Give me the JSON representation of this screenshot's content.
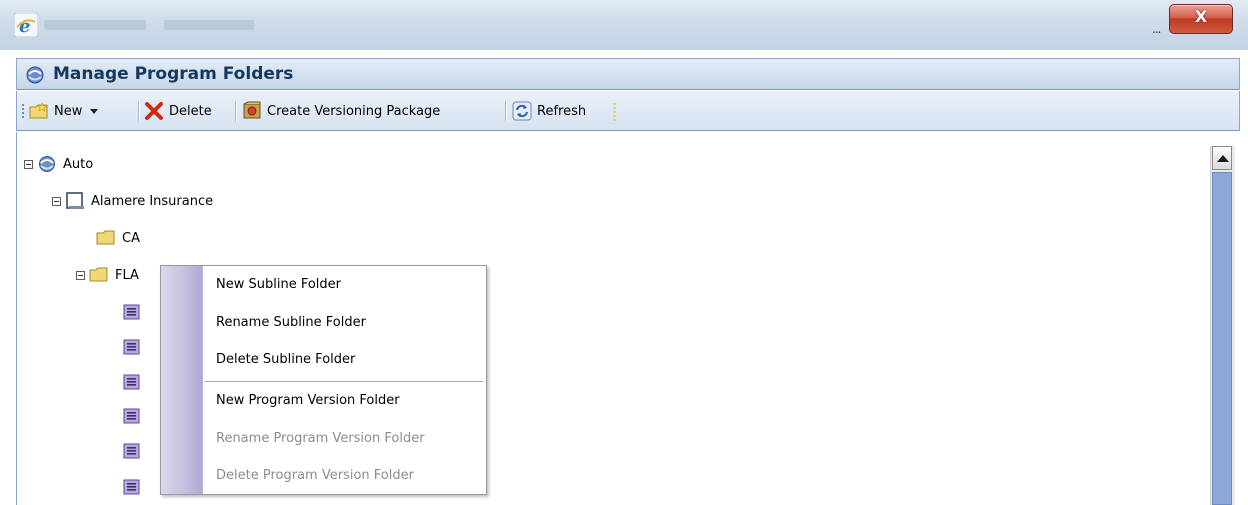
{
  "window": {
    "overflow_dots": "...",
    "close_glyph": "X"
  },
  "header": {
    "title": "Manage Program Folders"
  },
  "toolbar": {
    "new_label": "New",
    "delete_label": "Delete",
    "create_label": "Create Versioning Package",
    "refresh_label": "Refresh"
  },
  "tree": {
    "root": "Auto",
    "company": "Alamere Insurance",
    "folder_ca": "CA",
    "folder_fla": "FLA"
  },
  "context_menu": {
    "items": [
      {
        "label": "New Subline Folder",
        "enabled": true
      },
      {
        "label": "Rename Subline Folder",
        "enabled": true
      },
      {
        "label": "Delete Subline Folder",
        "enabled": true
      },
      {
        "label": "New Program Version Folder",
        "enabled": true
      },
      {
        "label": "Rename Program Version Folder",
        "enabled": false
      },
      {
        "label": "Delete Program Version Folder",
        "enabled": false
      }
    ]
  },
  "colors": {
    "header_text": "#15385e",
    "menu_gutter": "#c3bfdf",
    "scroll_thumb": "#8ca8d7",
    "close_button": "#c03a24"
  }
}
